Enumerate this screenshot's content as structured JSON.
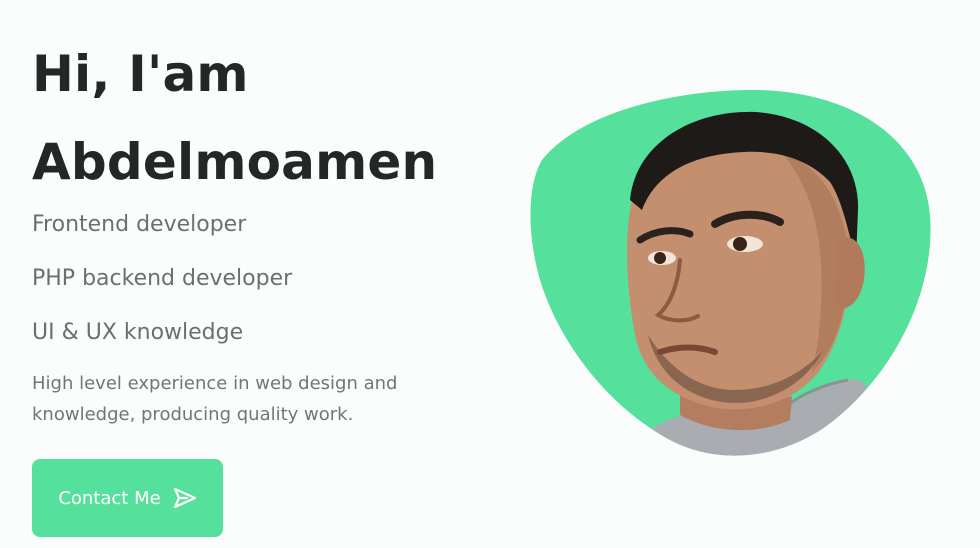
{
  "hero": {
    "greeting_line1": "Hi, I'am",
    "greeting_line2": "Abdelmoamen",
    "roles": [
      "Frontend developer",
      "PHP backend developer",
      "UI & UX knowledge"
    ],
    "description": "High level experience in web design and knowledge, producing quality work.",
    "contact_label": "Contact Me",
    "contact_icon": "send-icon"
  },
  "colors": {
    "accent": "#55e09c",
    "heading": "#232826",
    "text": "#66736d"
  }
}
